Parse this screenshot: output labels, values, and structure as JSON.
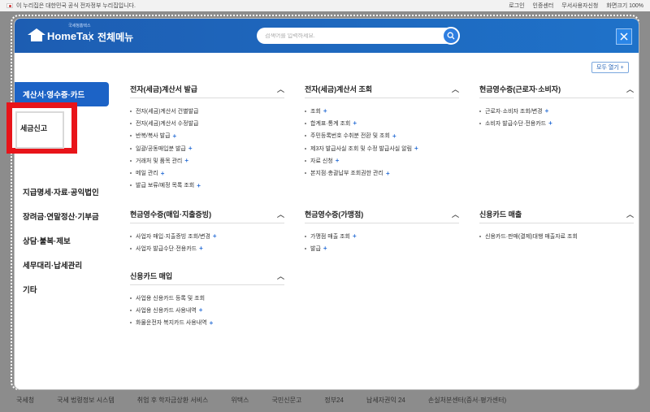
{
  "govbar": {
    "notice": "이 누리집은 대한민국 공식 전자정부 누리집입니다.",
    "links": [
      "로그인",
      "인증센터",
      "무서사용자신청",
      "화면크기 100%"
    ]
  },
  "header": {
    "logo_sub": "국세청홈택스",
    "logo_text": "HomeTax",
    "title": "전체메뉴",
    "search_placeholder": "검색어를 입력하세요."
  },
  "expand_all": "모두 열기 +",
  "sidebar": {
    "items": [
      "계산서·영수증·카드",
      "세금신고",
      "지급명세·자료·공익법인",
      "장려금·연말정산·기부금",
      "상담·불복·제보",
      "세무대리·납세관리",
      "기타"
    ]
  },
  "sections": [
    {
      "title": "전자(세금)계산서 발급",
      "items": [
        {
          "text": "전자(세금)계산서 건별발급",
          "plus": false
        },
        {
          "text": "전자(세금)계산서 수정발급",
          "plus": false
        },
        {
          "text": "반복/복사 발급",
          "plus": true
        },
        {
          "text": "일괄/공동매입분 발급",
          "plus": true
        },
        {
          "text": "거래처 및 품목 관리",
          "plus": true
        },
        {
          "text": "메일 관리",
          "plus": true
        },
        {
          "text": "발급 보류/예정 목록 조회",
          "plus": true
        }
      ]
    },
    {
      "title": "전자(세금)계산서 조회",
      "items": [
        {
          "text": "조회",
          "plus": true
        },
        {
          "text": "합계표·통계 조회",
          "plus": true
        },
        {
          "text": "주민등록번호 수취분 전환 및 조회",
          "plus": true
        },
        {
          "text": "제3자 발급사실 조회 및 수정 발급사실 알림",
          "plus": true
        },
        {
          "text": "자료 신청",
          "plus": true
        },
        {
          "text": "본지점·총괄납부 조회권한 관리",
          "plus": true
        }
      ]
    },
    {
      "title": "현금영수증(근로자·소비자)",
      "items": [
        {
          "text": "근로자·소비자 조회/변경",
          "plus": true
        },
        {
          "text": "소비자 발급수단·전용카드",
          "plus": true
        }
      ]
    },
    {
      "title": "현금영수증(매입·지출증빙)",
      "items": [
        {
          "text": "사업자 매입·지출증빙 조회/변경",
          "plus": true
        },
        {
          "text": "사업자 발급수단·전용카드",
          "plus": true
        }
      ]
    },
    {
      "title": "현금영수증(가맹점)",
      "items": [
        {
          "text": "가맹점 매출 조회",
          "plus": true
        },
        {
          "text": "발급",
          "plus": true
        }
      ]
    },
    {
      "title": "신용카드 매출",
      "items": [
        {
          "text": "신용카드·판매(결제)대행 매출자료 조회",
          "plus": false
        }
      ]
    },
    {
      "title": "신용카드 매입",
      "items": [
        {
          "text": "사업용 신용카드 등록 및 조회",
          "plus": false
        },
        {
          "text": "사업용 신용카드 사용내역",
          "plus": true
        },
        {
          "text": "화물운전자 복지카드 사용내역",
          "plus": true
        }
      ]
    }
  ],
  "footer": [
    "국세청",
    "국세 법령정보 시스템",
    "취업 후 학자금상환 서비스",
    "위택스",
    "국민신문고",
    "정부24",
    "납세자권익 24",
    "손실처분센터(증서·평가센터)"
  ],
  "colors": {
    "header": "#1d5db2",
    "active": "#1c63c6",
    "highlight": "#e8141a",
    "plus": "#2a6fd6"
  }
}
